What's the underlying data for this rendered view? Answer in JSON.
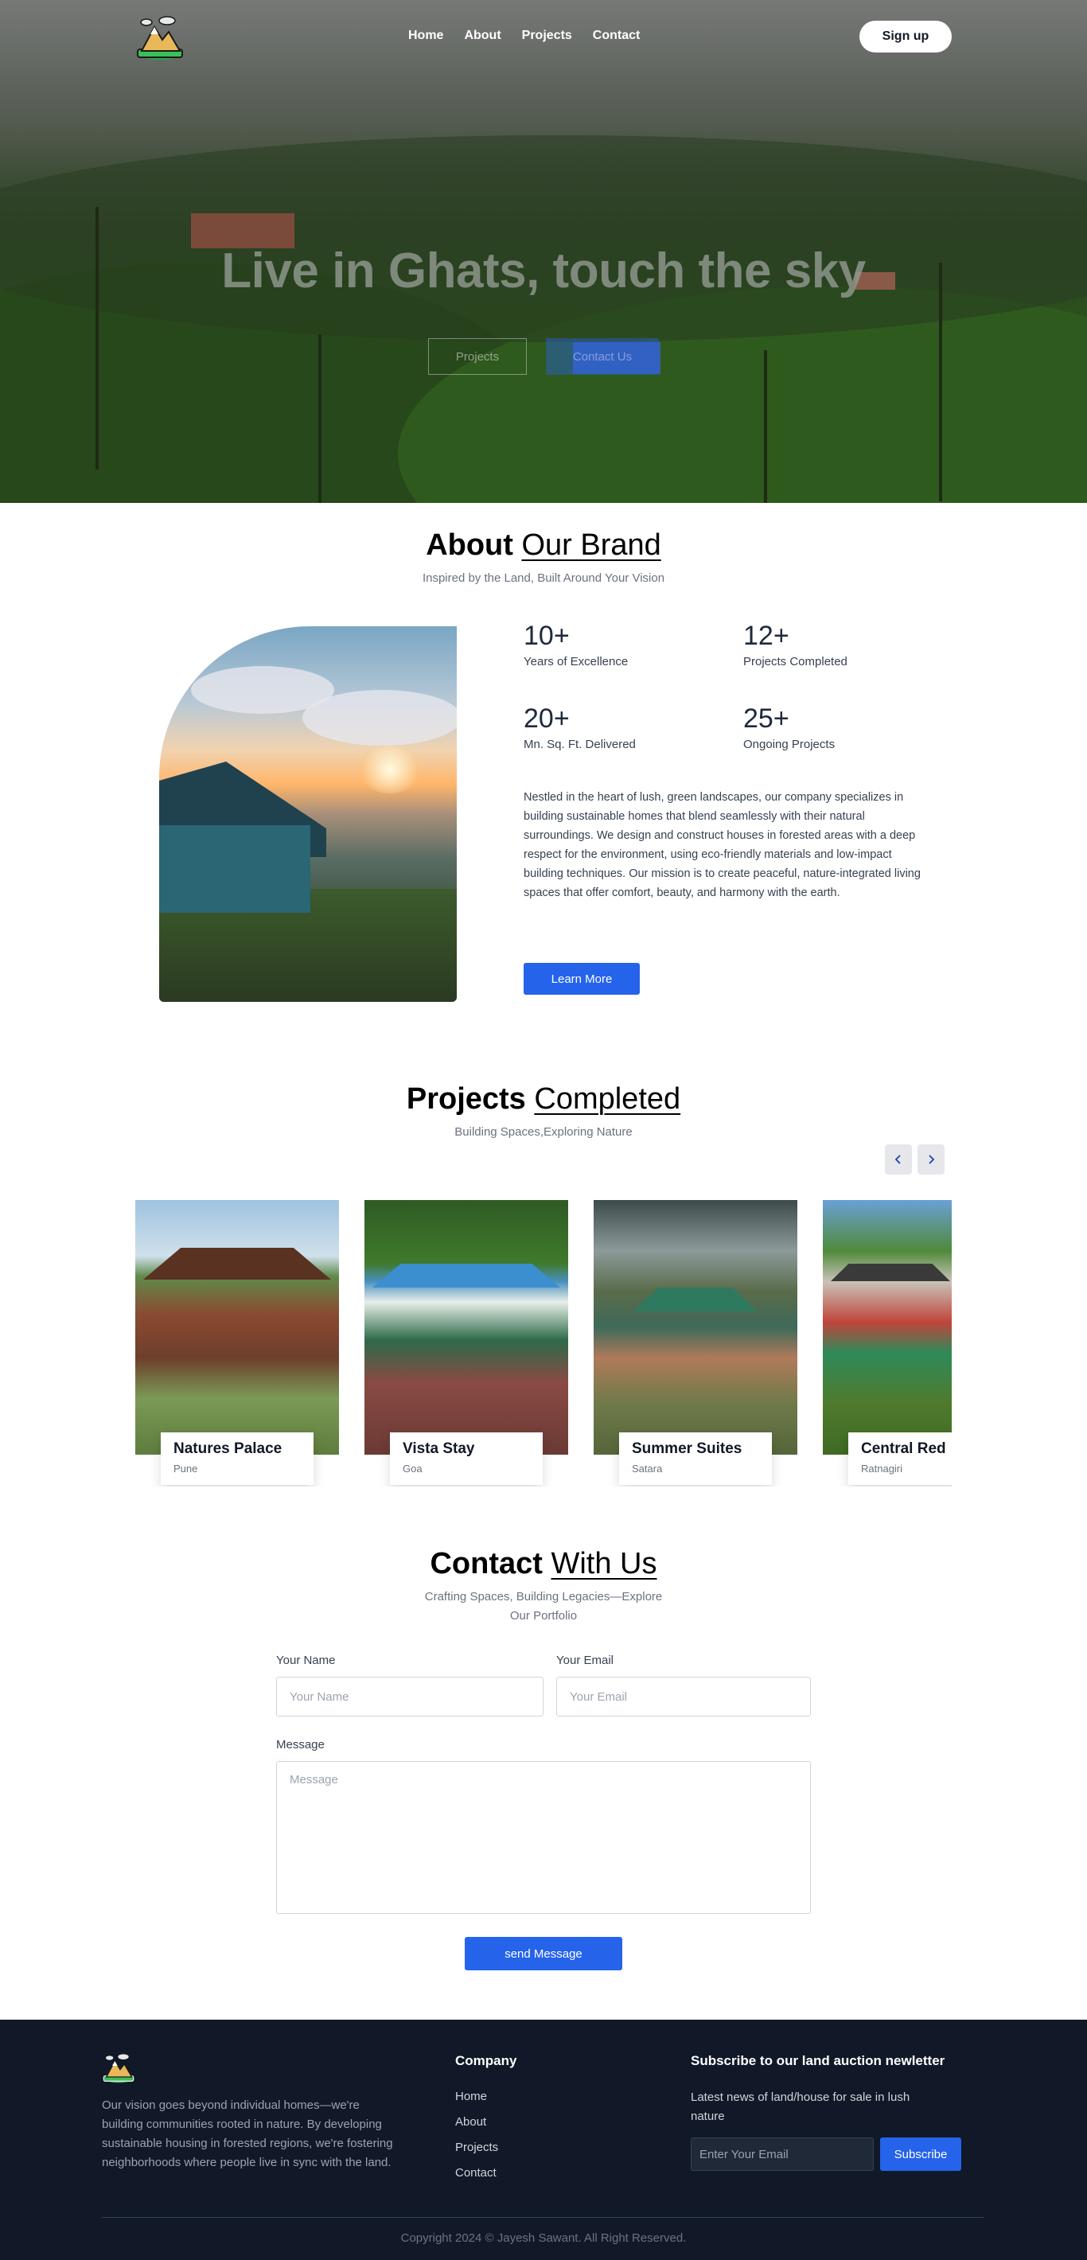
{
  "nav": {
    "links": [
      "Home",
      "About",
      "Projects",
      "Contact"
    ],
    "signup_label": "Sign up"
  },
  "hero": {
    "title": "Live in Ghats, touch the sky",
    "btn_projects": "Projects",
    "btn_contact": "Contact Us"
  },
  "about": {
    "heading_bold": "About",
    "heading_rest": "Our Brand",
    "subtitle": "Inspired by the Land, Built Around Your Vision",
    "stats": [
      {
        "num": "10+",
        "label": "Years of Excellence"
      },
      {
        "num": "12+",
        "label": "Projects Completed"
      },
      {
        "num": "20+",
        "label": "Mn. Sq. Ft. Delivered"
      },
      {
        "num": "25+",
        "label": "Ongoing Projects"
      }
    ],
    "text": "Nestled in the heart of lush, green landscapes, our company specializes in building sustainable homes that blend seamlessly with their natural surroundings. We design and construct houses in forested areas with a deep respect for the environment, using eco-friendly materials and low-impact building techniques. Our mission is to create peaceful, nature-integrated living spaces that offer comfort, beauty, and harmony with the earth.",
    "learn_more": "Learn More"
  },
  "projects": {
    "heading_bold": "Projects",
    "heading_rest": "Completed",
    "subtitle": "Building Spaces,Exploring Nature",
    "prev_icon": "chevron-left-icon",
    "next_icon": "chevron-right-icon",
    "items": [
      {
        "name": "Natures Palace",
        "location": "Pune"
      },
      {
        "name": "Vista Stay",
        "location": "Goa"
      },
      {
        "name": "Summer Suites",
        "location": "Satara"
      },
      {
        "name": "Central Red",
        "location": "Ratnagiri"
      }
    ]
  },
  "contact": {
    "heading_bold": "Contact",
    "heading_rest": "With Us",
    "subtitle_line1": "Crafting Spaces, Building Legacies—Explore",
    "subtitle_line2": "Our Portfolio",
    "name_label": "Your Name",
    "name_placeholder": "Your Name",
    "email_label": "Your Email",
    "email_placeholder": "Your Email",
    "message_label": "Message",
    "message_placeholder": "Message",
    "send_label": "send Message"
  },
  "footer": {
    "vision": "Our vision goes beyond individual homes—we're building communities rooted in nature. By developing sustainable housing in forested regions, we're fostering neighborhoods where people live in sync with the land.",
    "company_title": "Company",
    "company_links": [
      "Home",
      "About",
      "Projects",
      "Contact"
    ],
    "subscribe_title": "Subscribe to our land auction newletter",
    "subscribe_text": "Latest news of land/house for sale in lush nature",
    "email_placeholder": "Enter Your Email",
    "subscribe_button": "Subscribe",
    "copyright": "Copyright 2024 © Jayesh Sawant. All Right Reserved."
  },
  "colors": {
    "accent": "#2563eb",
    "footer_bg": "#111827"
  }
}
